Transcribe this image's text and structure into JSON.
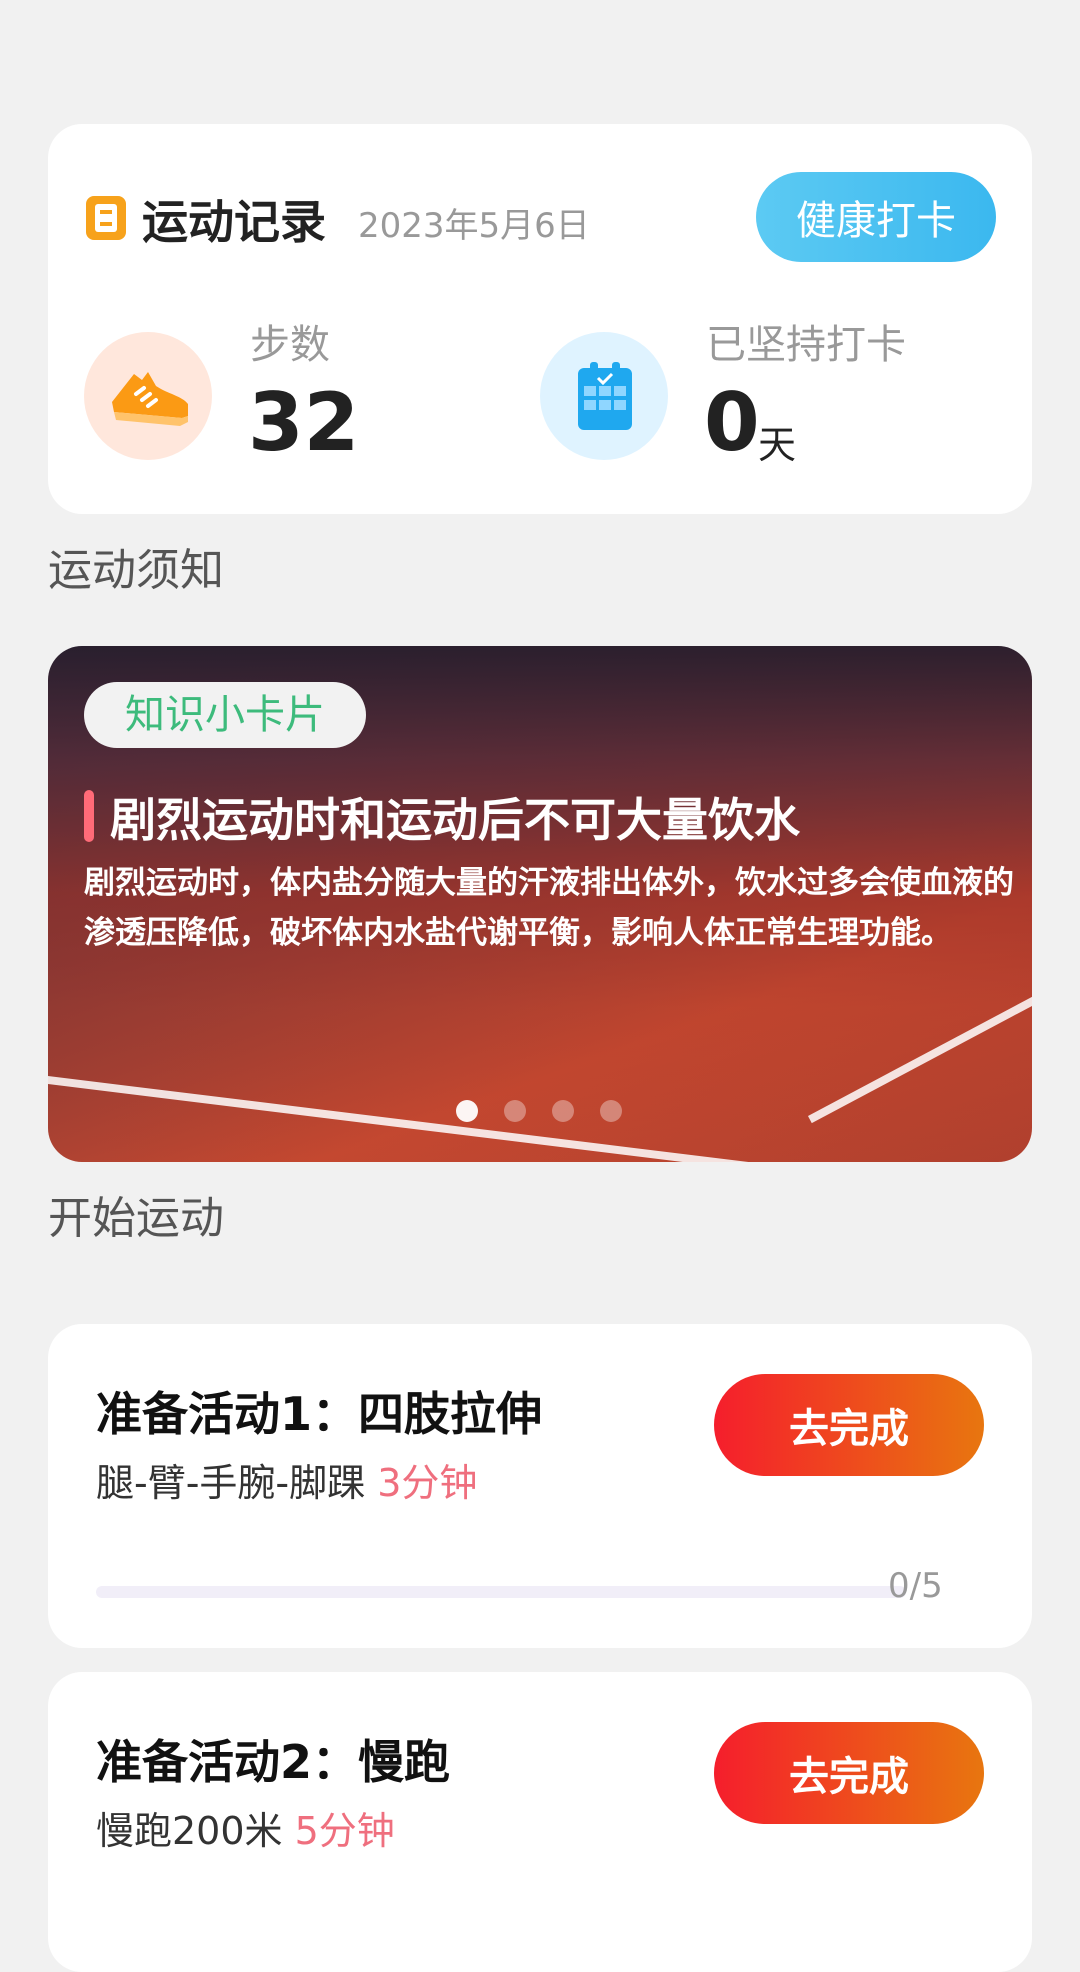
{
  "record": {
    "title": "运动记录",
    "date": "2023年5月6日",
    "checkin_label": "健康打卡",
    "steps_label": "步数",
    "steps_value": "32",
    "days_label": "已坚持打卡",
    "days_value": "0",
    "days_unit": "天",
    "icons": [
      "document-icon",
      "shoe-icon",
      "calendar-icon"
    ]
  },
  "sections": {
    "notice_title": "运动须知",
    "start_title": "开始运动"
  },
  "banner": {
    "badge": "知识小卡片",
    "heading": "剧烈运动时和运动后不可大量饮水",
    "body": "剧烈运动时，体内盐分随大量的汗液排出体外，饮水过多会使血液的渗透压降低，破坏体内水盐代谢平衡，影响人体正常生理功能。",
    "slides_total": 4,
    "active_slide": 1
  },
  "activities": [
    {
      "title": "准备活动1：四肢拉伸",
      "desc": "腿-臂-手腕-脚踝",
      "duration": "3分钟",
      "button": "去完成",
      "progress_text": "0/5",
      "progress": 0
    },
    {
      "title": "准备活动2：慢跑",
      "desc": "慢跑200米",
      "duration": "5分钟",
      "button": "去完成"
    }
  ],
  "colors": {
    "accent_blue": "#4ec1f1",
    "accent_orange": "#f7a21b",
    "accent_red": "#f51e2c",
    "duration_pink": "#ef6f7e",
    "badge_green": "#3dbb7c"
  }
}
